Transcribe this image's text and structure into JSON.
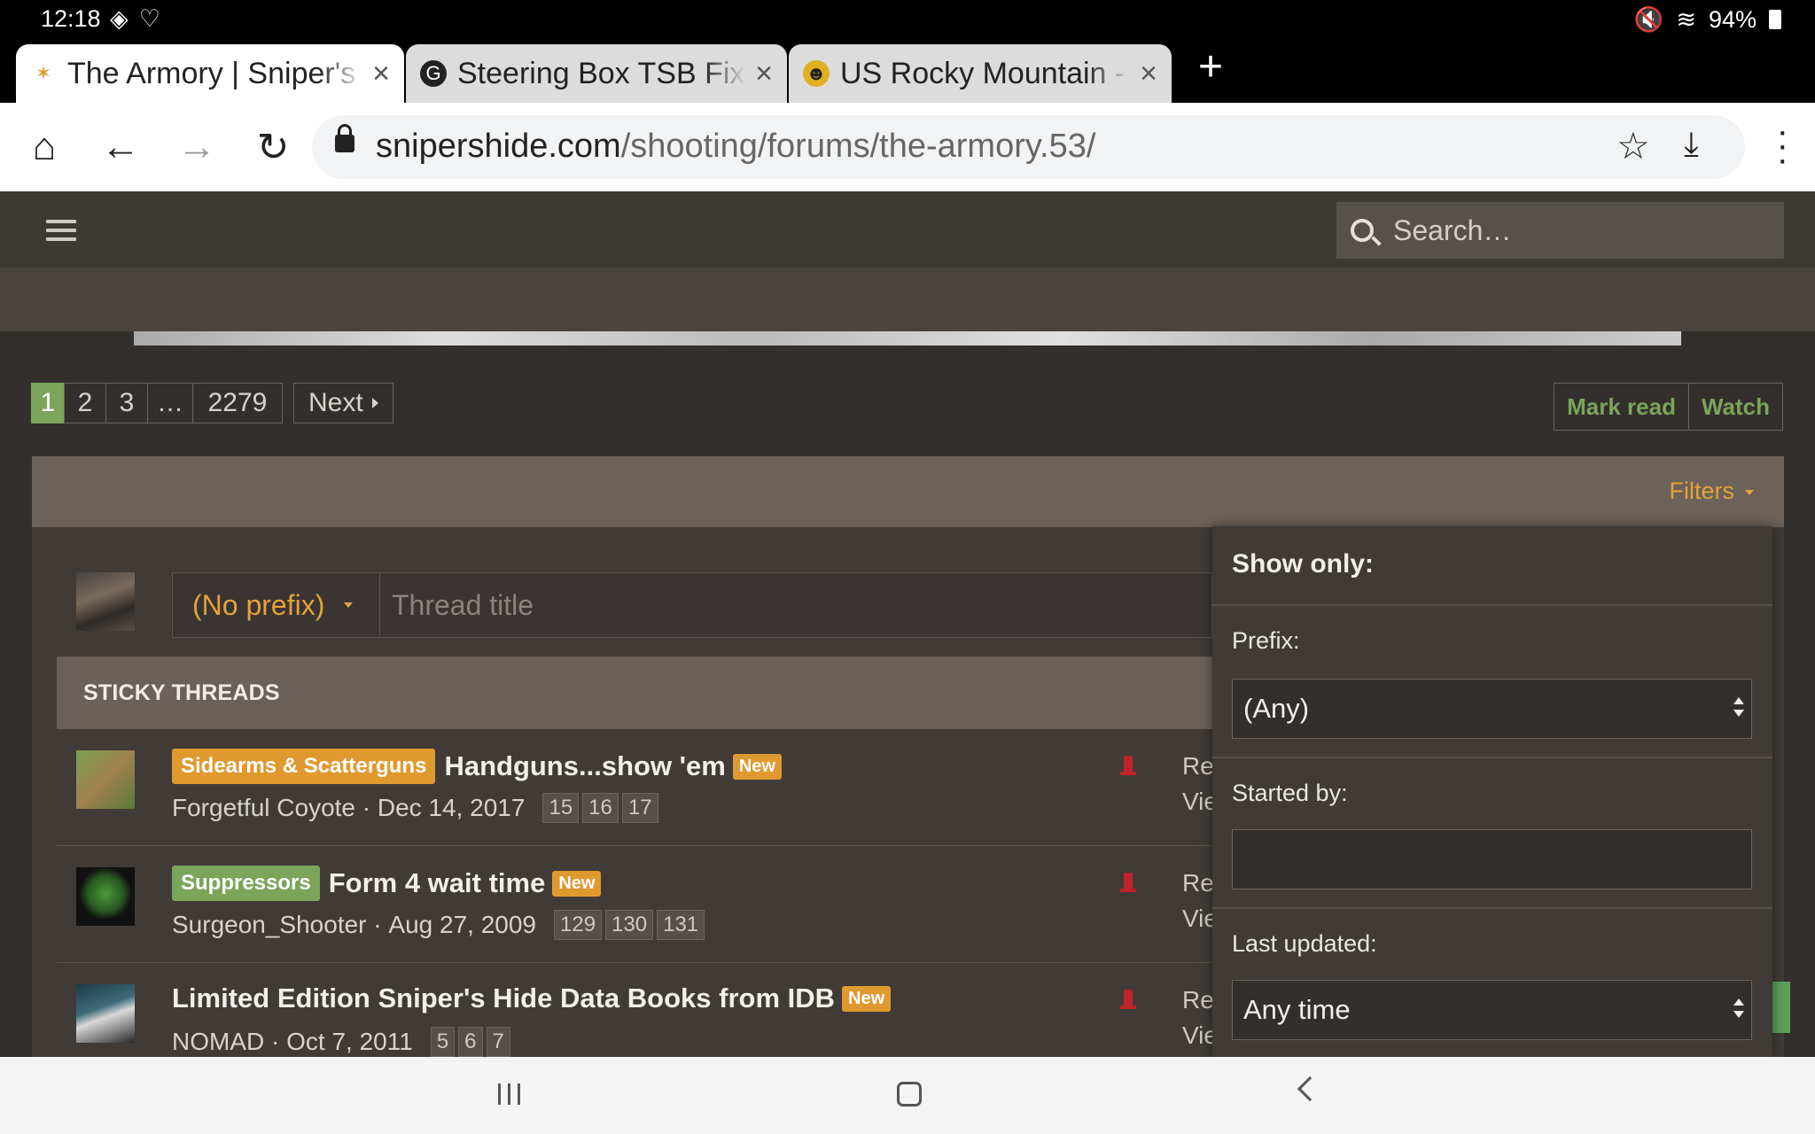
{
  "status": {
    "time": "12:18",
    "battery": "94%"
  },
  "tabs": [
    {
      "title": "The Armory | Sniper's Hide",
      "close": "×"
    },
    {
      "title": "Steering Box TSB Fix - ",
      "close": "×"
    },
    {
      "title": "US Rocky Mountain - W",
      "close": "×"
    }
  ],
  "new_tab": "+",
  "url": {
    "domain": "snipershide.com",
    "path": "/shooting/forums/the-armory.53/"
  },
  "site": {
    "search_placeholder": "Search…"
  },
  "pager": {
    "pages": [
      "1",
      "2",
      "3",
      "…",
      "2279"
    ],
    "next": "Next"
  },
  "actions": {
    "mark_read": "Mark read",
    "watch": "Watch"
  },
  "filters_label": "Filters",
  "new_thread": {
    "prefix": "(No prefix)",
    "title_placeholder": "Thread title"
  },
  "sticky_header": "STICKY THREADS",
  "threads": [
    {
      "prefix": "Sidearms & Scatterguns",
      "prefix_color": "orange",
      "title": "Handguns...show 'em",
      "new": "New",
      "author": "Forgetful Coyote",
      "date": "Dec 14, 2017",
      "pages": [
        "15",
        "16",
        "17"
      ],
      "stats1": "Re",
      "stats2": "Vie"
    },
    {
      "prefix": "Suppressors",
      "prefix_color": "green",
      "title": "Form 4 wait time",
      "new": "New",
      "author": "Surgeon_Shooter",
      "date": "Aug 27, 2009",
      "pages": [
        "129",
        "130",
        "131"
      ],
      "stats1": "Re",
      "stats2": "Vie"
    },
    {
      "prefix": "",
      "prefix_color": "",
      "title": "Limited Edition Sniper's Hide Data Books from IDB",
      "new": "New",
      "author": "NOMAD",
      "date": "Oct 7, 2011",
      "pages": [
        "5",
        "6",
        "7"
      ],
      "stats1": "Re",
      "stats2": "Vie"
    }
  ],
  "popup": {
    "title": "Show only:",
    "prefix_label": "Prefix:",
    "prefix_value": "(Any)",
    "started_by_label": "Started by:",
    "started_by_value": "",
    "last_updated_label": "Last updated:",
    "last_updated_value": "Any time"
  },
  "colors": {
    "accent_green": "#7aa55a",
    "accent_orange": "#e0992f",
    "header_bg": "#3d3935"
  }
}
